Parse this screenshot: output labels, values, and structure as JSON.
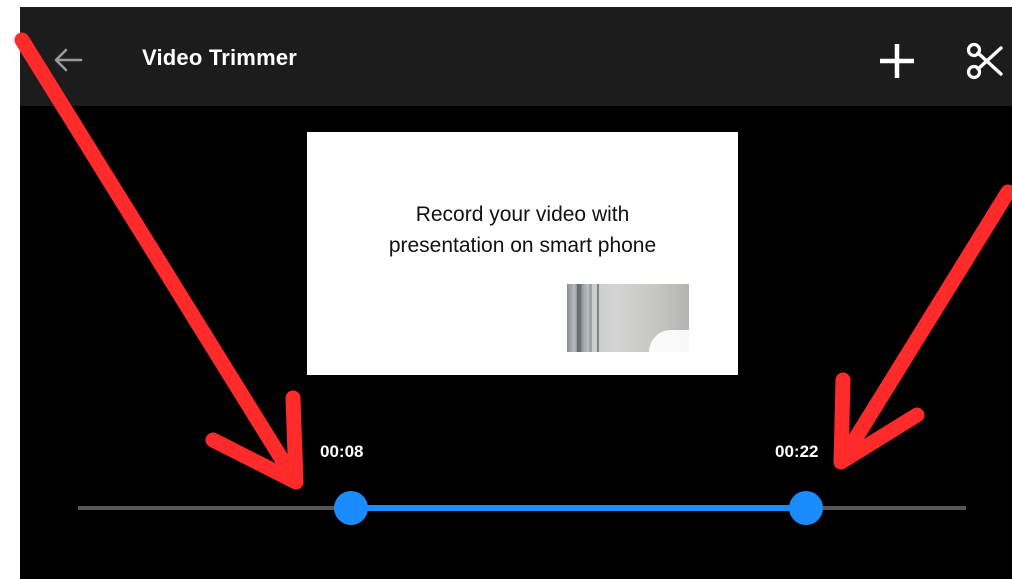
{
  "appbar": {
    "title": "Video Trimmer",
    "back_icon": "arrow-left-icon",
    "add_icon": "plus-icon",
    "cut_icon": "scissors-icon"
  },
  "preview": {
    "slide_line1": "Record your video with",
    "slide_line2": "presentation on smart phone"
  },
  "trimmer": {
    "start_time": "00:08",
    "end_time": "00:22",
    "start_fraction": 0.31,
    "end_fraction": 0.82
  },
  "colors": {
    "appbar_bg": "#1c1c1c",
    "background": "#000000",
    "accent": "#1a8cff",
    "track": "#555555",
    "annotation_arrows": "#ff2a2a"
  }
}
